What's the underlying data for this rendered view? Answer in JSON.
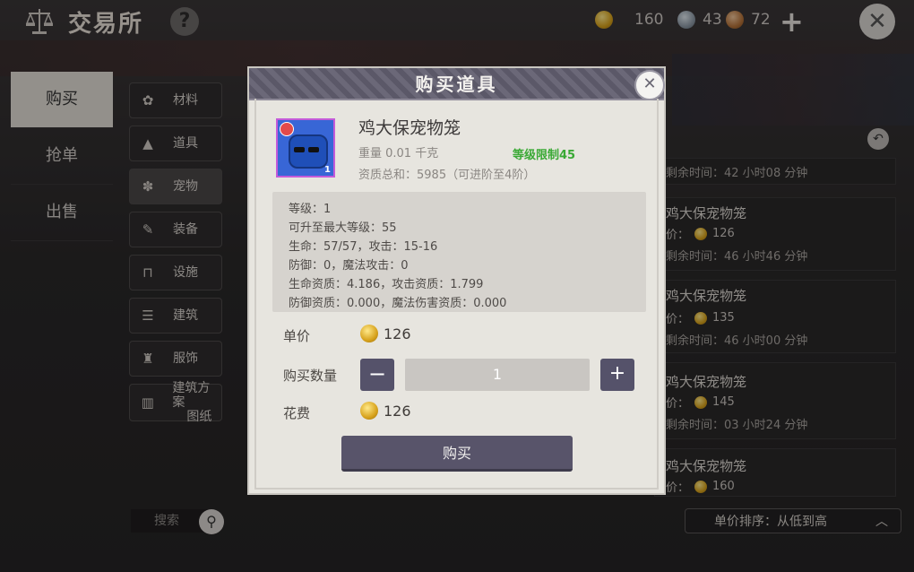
{
  "header": {
    "title": "交易所",
    "help_label": "?",
    "currency": [
      {
        "name": "gold",
        "value": "160"
      },
      {
        "name": "silver",
        "value": "43"
      },
      {
        "name": "bronze",
        "value": "72"
      }
    ],
    "add_label": "+",
    "close_label": "✕"
  },
  "left_tabs": [
    {
      "label": "购买",
      "active": true
    },
    {
      "label": "抢单",
      "active": false
    },
    {
      "label": "出售",
      "active": false
    }
  ],
  "categories": [
    {
      "label": "材料",
      "icon": "material-icon"
    },
    {
      "label": "道具",
      "icon": "item-icon"
    },
    {
      "label": "宠物",
      "icon": "pet-paw-icon",
      "active": true
    },
    {
      "label": "装备",
      "icon": "equipment-icon"
    },
    {
      "label": "设施",
      "icon": "facility-icon"
    },
    {
      "label": "建筑",
      "icon": "building-icon"
    },
    {
      "label": "服饰",
      "icon": "clothing-icon"
    },
    {
      "label_line1": "建筑方案",
      "label_line2": "图纸",
      "icon": "blueprint-icon"
    }
  ],
  "search": {
    "label": "搜索",
    "icon": "search-icon"
  },
  "listing": {
    "rows": [
      {
        "time": "剩余时间：42 小时08 分钟"
      },
      {
        "name": "鸡大保宠物笼",
        "price": "126",
        "time": "剩余时间：46 小时46 分钟",
        "price_label": "价："
      },
      {
        "name": "鸡大保宠物笼",
        "price": "135",
        "time": "剩余时间：46 小时00 分钟",
        "price_label": "价："
      },
      {
        "name": "鸡大保宠物笼",
        "price": "145",
        "time": "剩余时间：03 小时24 分钟",
        "price_label": "价："
      },
      {
        "name": "鸡大保宠物笼",
        "price": "160",
        "price_label": "价："
      }
    ],
    "name_prefix_visible": "鸡大保宠物笼"
  },
  "sort": {
    "label": "单价排序：从低到高"
  },
  "modal": {
    "title": "购买道具",
    "item": {
      "name": "鸡大保宠物笼",
      "weight": "重量   0.01 千克",
      "level_limit": "等级限制45",
      "quality": "资质总和：5985（可进阶至4阶）",
      "badge_num": "1"
    },
    "stats": [
      "等级：1",
      "可升至最大等级：55",
      "生命：57/57，攻击：15-16",
      "防御：0，魔法攻击：0",
      "生命资质：4.186，攻击资质：1.799",
      "防御资质：0.000，魔法伤害资质：0.000"
    ],
    "unit_price_label": "单价",
    "unit_price": "126",
    "quantity_label": "购买数量",
    "quantity": "1",
    "minus_label": "−",
    "plus_label": "+",
    "cost_label": "花费",
    "cost": "126",
    "buy_label": "购买"
  }
}
